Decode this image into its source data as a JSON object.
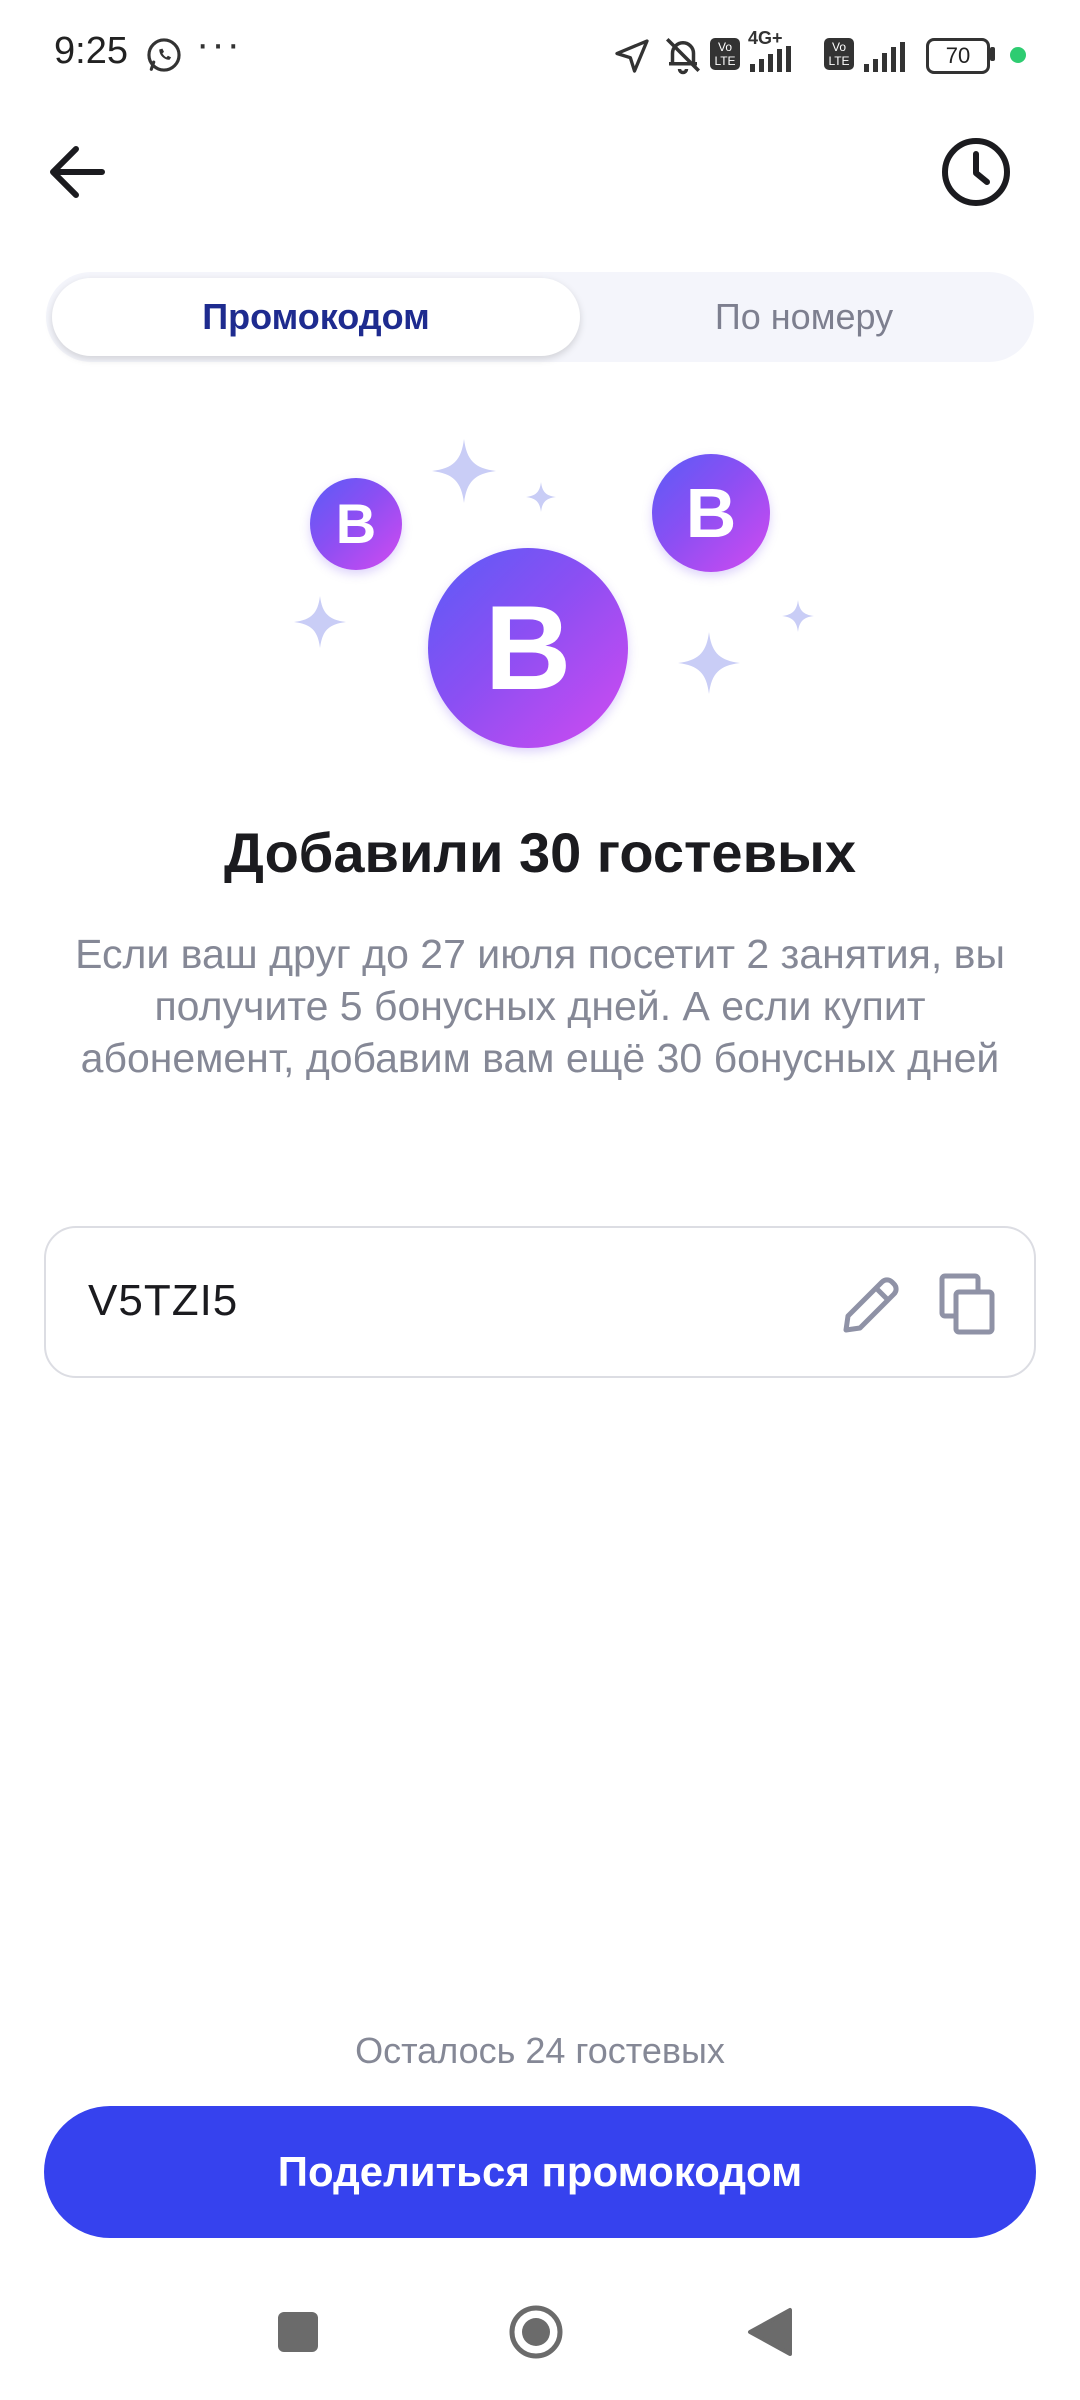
{
  "status_bar": {
    "time": "9:25",
    "network": "4G+",
    "volte_label": "Vo LTE",
    "battery": "70"
  },
  "tabs": [
    {
      "label": "Промокодом",
      "active": true
    },
    {
      "label": "По номеру",
      "active": false
    }
  ],
  "coins": {
    "letter": "B"
  },
  "content": {
    "title": "Добавили 30 гостевых",
    "description": "Если ваш друг до 27 июля посетит 2 занятия, вы получите 5 бонусных дней. А если купит абонемент, добавим вам ещё 30 бонусных дней"
  },
  "promo": {
    "code": "V5TZI5"
  },
  "footer": {
    "remaining": "Осталось 24 гостевых",
    "share_label": "Поделиться промокодом"
  },
  "colors": {
    "accent": "#3642ee",
    "active_tab_text": "#1e2b8f",
    "coin_gradient_start": "#5a5cf7",
    "coin_gradient_end": "#d24af0",
    "sparkle": "#c9cdf6"
  }
}
